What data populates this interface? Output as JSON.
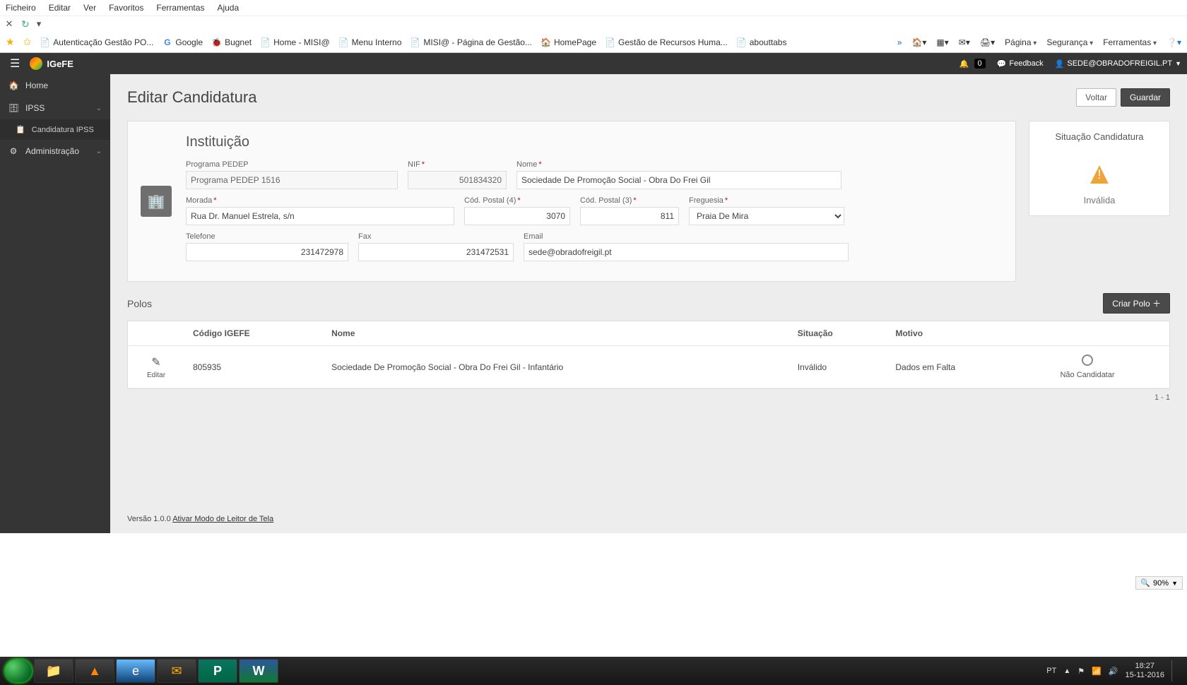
{
  "ie_menu": [
    "Ficheiro",
    "Editar",
    "Ver",
    "Favoritos",
    "Ferramentas",
    "Ajuda"
  ],
  "bookmarks": [
    {
      "icon": "📄",
      "label": "Autenticação  Gestão PO..."
    },
    {
      "icon": "G",
      "label": "Google"
    },
    {
      "icon": "🐞",
      "label": "Bugnet"
    },
    {
      "icon": "📄",
      "label": "Home - MISI@"
    },
    {
      "icon": "📄",
      "label": "Menu Interno"
    },
    {
      "icon": "📄",
      "label": "MISI@ - Página de Gestão..."
    },
    {
      "icon": "🏠",
      "label": "HomePage"
    },
    {
      "icon": "📄",
      "label": "Gestão de Recursos Huma..."
    },
    {
      "icon": "📄",
      "label": "abouttabs"
    }
  ],
  "ie_right_menu": [
    "Página",
    "Segurança",
    "Ferramentas"
  ],
  "topbar": {
    "brand": "IGeFE",
    "notif_count": "0",
    "feedback": "Feedback",
    "user": "SEDE@OBRADOFREIGIL.PT"
  },
  "sidebar": {
    "items": [
      {
        "icon": "🏠",
        "label": "Home",
        "chev": false
      },
      {
        "icon": "🗄",
        "label": "IPSS",
        "chev": true
      },
      {
        "icon": "⚙",
        "label": "Administração",
        "chev": true
      }
    ],
    "sub_ipss": {
      "icon": "📋",
      "label": "Candidatura IPSS"
    }
  },
  "page": {
    "title": "Editar Candidatura",
    "btn_back": "Voltar",
    "btn_save": "Guardar"
  },
  "inst": {
    "heading": "Instituição",
    "prog_label": "Programa PEDEP",
    "prog_value": "Programa PEDEP 1516",
    "nif_label": "NIF",
    "nif_value": "501834320",
    "nome_label": "Nome",
    "nome_value": "Sociedade De Promoção Social - Obra Do Frei Gil",
    "morada_label": "Morada",
    "morada_value": "Rua Dr. Manuel Estrela, s/n",
    "cp4_label": "Cód. Postal (4)",
    "cp4_value": "3070",
    "cp3_label": "Cód. Postal (3)",
    "cp3_value": "811",
    "freg_label": "Freguesia",
    "freg_value": "Praia De Mira",
    "tel_label": "Telefone",
    "tel_value": "231472978",
    "fax_label": "Fax",
    "fax_value": "231472531",
    "email_label": "Email",
    "email_value": "sede@obradofreigil.pt"
  },
  "status": {
    "title": "Situação Candidatura",
    "state": "Inválida"
  },
  "polos": {
    "title": "Polos",
    "create_btn": "Criar Polo",
    "cols": {
      "code": "Código IGEFE",
      "nome": "Nome",
      "sit": "Situação",
      "mot": "Motivo"
    },
    "edit_label": "Editar",
    "rows": [
      {
        "code": "805935",
        "nome": "Sociedade De Promoção Social - Obra Do Frei Gil - Infantário",
        "sit": "Inválido",
        "mot": "Dados em Falta",
        "radio_label": "Não Candidatar"
      }
    ],
    "pager": "1 - 1"
  },
  "footer": {
    "version": "Versão 1.0.0 ",
    "link": "Ativar Modo de Leitor de Tela"
  },
  "zoom": "90%",
  "taskbar": {
    "lang": "PT",
    "time": "18:27",
    "date": "15-11-2016"
  }
}
